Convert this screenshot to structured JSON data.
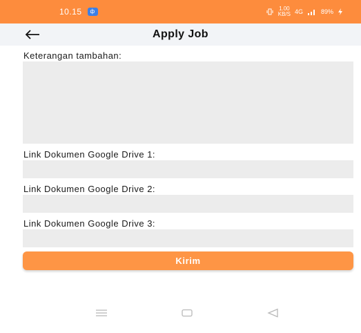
{
  "status_bar": {
    "time": "10.15",
    "notification_badge": "ф",
    "net_speed": "1.00",
    "net_unit": "KB/S",
    "network_type": "4G",
    "battery": "89%"
  },
  "header": {
    "title": "Apply Job"
  },
  "form": {
    "description_label": "Keterangan tambahan:",
    "description_value": "",
    "link1_label": "Link Dokumen Google Drive 1:",
    "link1_value": "",
    "link2_label": "Link Dokumen Google Drive 2:",
    "link2_value": "",
    "link3_label": "Link Dokumen Google Drive 3:",
    "link3_value": "",
    "submit_label": "Kirim"
  },
  "colors": {
    "accent": "#fd8c3d",
    "button": "#fe9545",
    "field_bg": "#ececec"
  },
  "icons": {
    "back": "arrow-left-icon",
    "nav_menu": "menu-icon",
    "nav_home": "home-icon",
    "nav_back": "triangle-back-icon"
  }
}
